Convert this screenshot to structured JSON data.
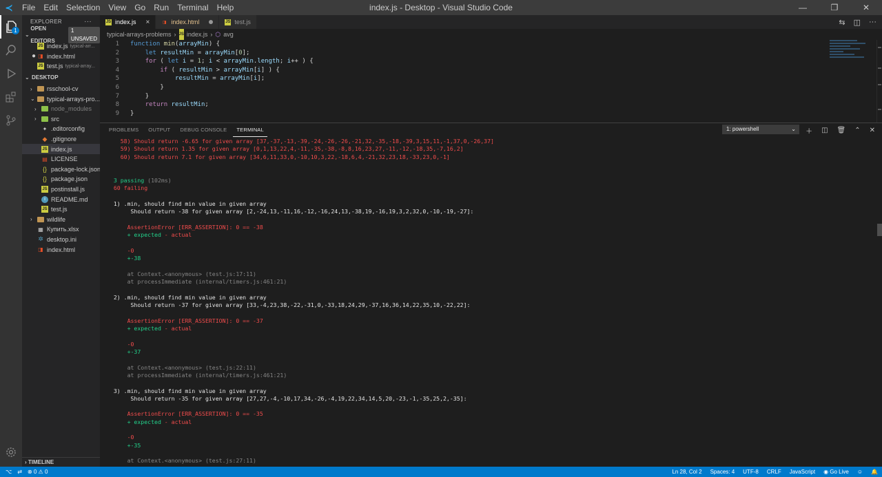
{
  "titlebar": {
    "menu": [
      "File",
      "Edit",
      "Selection",
      "View",
      "Go",
      "Run",
      "Terminal",
      "Help"
    ],
    "title": "index.js - Desktop - Visual Studio Code"
  },
  "activity": {
    "explorer_badge": "1"
  },
  "sidebar": {
    "header": "EXPLORER",
    "open_editors_label": "OPEN EDITORS",
    "unsaved_badge": "1 UNSAVED",
    "open_editors": [
      {
        "name": "index.js",
        "sub": "typical-arr...",
        "icon": "js-file-icon"
      },
      {
        "name": "index.html",
        "sub": "",
        "icon": "html-file-icon",
        "modified": true
      },
      {
        "name": "test.js",
        "sub": "typical-array...",
        "icon": "js-file-icon"
      }
    ],
    "desktop_label": "DESKTOP",
    "tree": [
      {
        "name": "rsschool-cv",
        "type": "folder",
        "level": 1,
        "chev": "›"
      },
      {
        "name": "typical-arrays-pro...",
        "type": "folder",
        "level": 1,
        "chev": "⌄"
      },
      {
        "name": "node_modules",
        "type": "folder-green",
        "level": 2,
        "chev": "›",
        "dim": true
      },
      {
        "name": "src",
        "type": "folder-green",
        "level": 2,
        "chev": "›"
      },
      {
        "name": ".editorconfig",
        "type": "editorconfig",
        "level": 2
      },
      {
        "name": ".gitignore",
        "type": "git",
        "level": 2
      },
      {
        "name": "index.js",
        "type": "js",
        "level": 2,
        "selected": true
      },
      {
        "name": "LICENSE",
        "type": "license",
        "level": 2
      },
      {
        "name": "package-lock.json",
        "type": "json",
        "level": 2
      },
      {
        "name": "package.json",
        "type": "json",
        "level": 2
      },
      {
        "name": "postinstall.js",
        "type": "js",
        "level": 2
      },
      {
        "name": "README.md",
        "type": "info",
        "level": 2
      },
      {
        "name": "test.js",
        "type": "js",
        "level": 2
      },
      {
        "name": "wildlife",
        "type": "folder",
        "level": 1,
        "chev": "›"
      },
      {
        "name": "Купить.xlsx",
        "type": "xls",
        "level": 1
      },
      {
        "name": "desktop.ini",
        "type": "ini",
        "level": 1
      },
      {
        "name": "index.html",
        "type": "html",
        "level": 1
      }
    ],
    "timeline_label": "TIMELINE"
  },
  "tabs": [
    {
      "name": "index.js",
      "active": true,
      "close": "×"
    },
    {
      "name": "index.html",
      "active": false,
      "modified": true
    },
    {
      "name": "test.js",
      "active": false
    }
  ],
  "breadcrumb": [
    "typical-arrays-problems",
    "index.js",
    "avg"
  ],
  "code_lines": [
    "function min(arrayMin) {",
    "    let resultMin = arrayMin[0];",
    "    for ( let i = 1; i < arrayMin.length; i++ ) {",
    "        if ( resultMin > arrayMin[i] ) {",
    "            resultMin = arrayMin[i];",
    "        }",
    "    }",
    "    return resultMin;",
    "}"
  ],
  "panel": {
    "tabs": [
      "PROBLEMS",
      "OUTPUT",
      "DEBUG CONSOLE",
      "TERMINAL"
    ],
    "active_tab": "TERMINAL",
    "terminal_select": "1: powershell"
  },
  "terminal_lines": [
    {
      "t": "    58) Should return -6.65 for given array [37,-37,-13,-39,-24,-26,-26,-21,32,-35,-18,-39,3,15,11,-1,37,0,-26,37]",
      "c": "red"
    },
    {
      "t": "    59) Should return 1.35 for given array [0,1,13,22,4,-11,-35,-38,-8,8,16,23,27,-11,-12,-18,35,-7,16,2]",
      "c": "red"
    },
    {
      "t": "    60) Should return 7.1 for given array [34,6,11,33,0,-10,10,3,22,-18,6,4,-21,32,23,18,-33,23,0,-1]",
      "c": "red"
    },
    {
      "t": "",
      "c": ""
    },
    {
      "t": "",
      "c": ""
    },
    {
      "t": "  3 passing",
      "c": "green",
      "extra": " (102ms)"
    },
    {
      "t": "  60 failing",
      "c": "red"
    },
    {
      "t": "",
      "c": ""
    },
    {
      "t": "  1) .min, should find min value in given array",
      "c": "white"
    },
    {
      "t": "       Should return -38 for given array [2,-24,13,-11,16,-12,-16,24,13,-38,19,-16,19,3,2,32,0,-10,-19,-27]:",
      "c": "white"
    },
    {
      "t": "",
      "c": ""
    },
    {
      "t": "      AssertionError [ERR_ASSERTION]: 0 == -38",
      "c": "red"
    },
    {
      "t": "      + expected - actual",
      "c": "mixed"
    },
    {
      "t": "",
      "c": ""
    },
    {
      "t": "      -0",
      "c": "red"
    },
    {
      "t": "      +-38",
      "c": "green"
    },
    {
      "t": "",
      "c": ""
    },
    {
      "t": "      at Context.<anonymous> (test.js:17:11)",
      "c": "grey"
    },
    {
      "t": "      at processImmediate (internal/timers.js:461:21)",
      "c": "grey"
    },
    {
      "t": "",
      "c": ""
    },
    {
      "t": "  2) .min, should find min value in given array",
      "c": "white"
    },
    {
      "t": "       Should return -37 for given array [33,-4,23,38,-22,-31,0,-33,18,24,29,-37,16,36,14,22,35,10,-22,22]:",
      "c": "white"
    },
    {
      "t": "",
      "c": ""
    },
    {
      "t": "      AssertionError [ERR_ASSERTION]: 0 == -37",
      "c": "red"
    },
    {
      "t": "      + expected - actual",
      "c": "mixed"
    },
    {
      "t": "",
      "c": ""
    },
    {
      "t": "      -0",
      "c": "red"
    },
    {
      "t": "      +-37",
      "c": "green"
    },
    {
      "t": "",
      "c": ""
    },
    {
      "t": "      at Context.<anonymous> (test.js:22:11)",
      "c": "grey"
    },
    {
      "t": "      at processImmediate (internal/timers.js:461:21)",
      "c": "grey"
    },
    {
      "t": "",
      "c": ""
    },
    {
      "t": "  3) .min, should find min value in given array",
      "c": "white"
    },
    {
      "t": "       Should return -35 for given array [27,27,-4,-10,17,34,-26,-4,19,22,34,14,5,20,-23,-1,-35,25,2,-35]:",
      "c": "white"
    },
    {
      "t": "",
      "c": ""
    },
    {
      "t": "      AssertionError [ERR_ASSERTION]: 0 == -35",
      "c": "red"
    },
    {
      "t": "      + expected - actual",
      "c": "mixed"
    },
    {
      "t": "",
      "c": ""
    },
    {
      "t": "      -0",
      "c": "red"
    },
    {
      "t": "      +-35",
      "c": "green"
    },
    {
      "t": "",
      "c": ""
    },
    {
      "t": "      at Context.<anonymous> (test.js:27:11)",
      "c": "grey"
    }
  ],
  "statusbar": {
    "errors": "0",
    "warnings": "0",
    "position": "Ln 28, Col 2",
    "spaces": "Spaces: 4",
    "encoding": "UTF-8",
    "eol": "CRLF",
    "language": "JavaScript",
    "golive": "Go Live"
  },
  "colors": {
    "accent": "#007acc",
    "error": "#f14c4c",
    "pass": "#23d18b"
  }
}
